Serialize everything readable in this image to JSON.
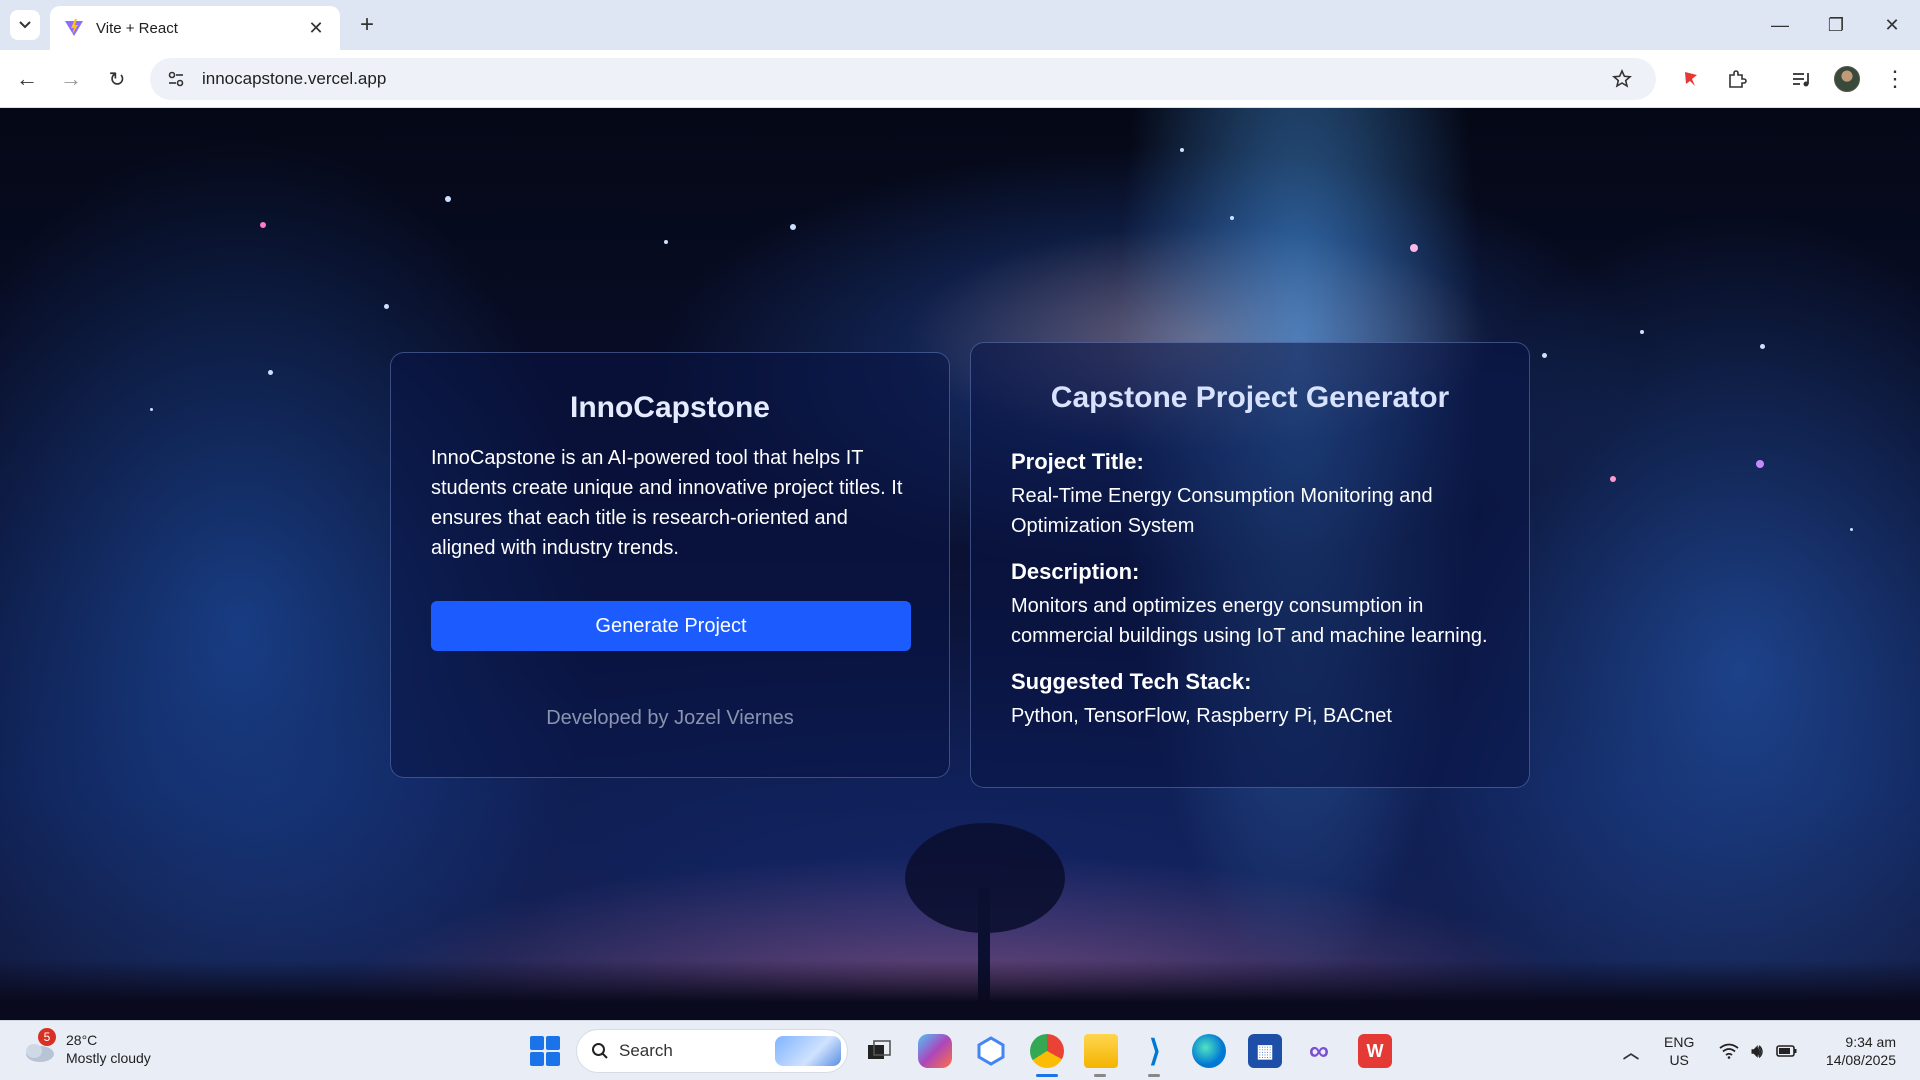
{
  "browser": {
    "tab_title": "Vite + React",
    "url": "innocapstone.vercel.app"
  },
  "app": {
    "left_card": {
      "title": "InnoCapstone",
      "description": "InnoCapstone is an AI-powered tool that helps IT students create unique and innovative project titles. It ensures that each title is research-oriented and aligned with industry trends.",
      "button_label": "Generate Project",
      "credit": "Developed by Jozel Viernes"
    },
    "right_card": {
      "title": "Capstone Project Generator",
      "project_title_label": "Project Title:",
      "project_title_value": "Real-Time Energy Consumption Monitoring and Optimization System",
      "description_label": "Description:",
      "description_value": "Monitors and optimizes energy consumption in commercial buildings using IoT and machine learning.",
      "tech_stack_label": "Suggested Tech Stack:",
      "tech_stack_value": "Python, TensorFlow, Raspberry Pi, BACnet"
    },
    "colors": {
      "button": "#1c5cff",
      "card_bg": "rgba(10,20,70,0.55)"
    }
  },
  "taskbar": {
    "weather": {
      "badge": "5",
      "temperature": "28°C",
      "condition": "Mostly cloudy"
    },
    "search_label": "Search",
    "language": "ENG",
    "region": "US",
    "time": "9:34 am",
    "date": "14/08/2025"
  }
}
